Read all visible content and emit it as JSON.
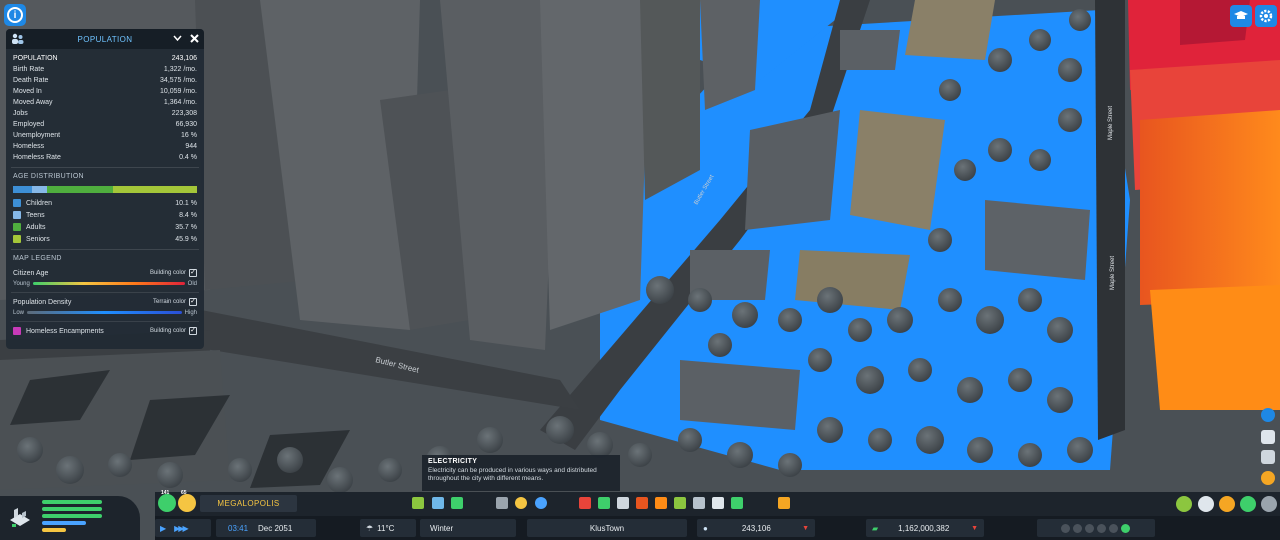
{
  "population_panel": {
    "title": "POPULATION",
    "stats": [
      {
        "label": "POPULATION",
        "value": "243,106"
      },
      {
        "label": "Birth Rate",
        "value": "1,322 /mo."
      },
      {
        "label": "Death Rate",
        "value": "34,575 /mo."
      },
      {
        "label": "Moved In",
        "value": "10,059 /mo."
      },
      {
        "label": "Moved Away",
        "value": "1,364 /mo."
      },
      {
        "label": "Jobs",
        "value": "223,308"
      },
      {
        "label": "Employed",
        "value": "66,930"
      },
      {
        "label": "Unemployment",
        "value": "16 %"
      },
      {
        "label": "Homeless",
        "value": "944"
      },
      {
        "label": "Homeless Rate",
        "value": "0.4 %"
      }
    ],
    "age_distribution": {
      "title": "AGE DISTRIBUTION",
      "groups": [
        {
          "label": "Children",
          "value": "10.1 %",
          "share": 10.1,
          "color": "#3d8fd6"
        },
        {
          "label": "Teens",
          "value": "8.4 %",
          "share": 8.4,
          "color": "#86b8e8"
        },
        {
          "label": "Adults",
          "value": "35.7 %",
          "share": 35.7,
          "color": "#4fae3e"
        },
        {
          "label": "Seniors",
          "value": "45.9 %",
          "share": 45.9,
          "color": "#a4c639"
        }
      ]
    },
    "map_legend": {
      "title": "MAP LEGEND",
      "citizen_age": {
        "label": "Citizen Age",
        "mode": "Building color",
        "low": "Young",
        "high": "Old"
      },
      "population_density": {
        "label": "Population Density",
        "mode": "Terrain color",
        "low": "Low",
        "high": "High"
      },
      "homeless_encampments": {
        "label": "Homeless Encampments",
        "mode": "Building color",
        "color": "#c83ab8"
      }
    }
  },
  "street_labels": {
    "butler_street_main": "Butler Street",
    "butler_street_side": "Butler Street",
    "maple_street_top": "Maple Street",
    "maple_street_mid": "Maple Street"
  },
  "tooltip": {
    "title": "ELECTRICITY",
    "body": "Electricity can be produced in various ways and distributed throughout the city with different means."
  },
  "bottom_bar": {
    "city_name": "MEGALOPOLIS",
    "xp_badge": "141",
    "level_badge": "65",
    "time": "03:41",
    "date": "Dec 2051",
    "temperature": "11°C",
    "season": "Winter",
    "region": "KlusTown",
    "population": "243,106",
    "money": "1,162,000,382"
  },
  "colors": {
    "accent": "#1e88e5",
    "panel_title": "#6fc3ff",
    "gold": "#f5c542",
    "density_blue": "#1f8fff"
  }
}
